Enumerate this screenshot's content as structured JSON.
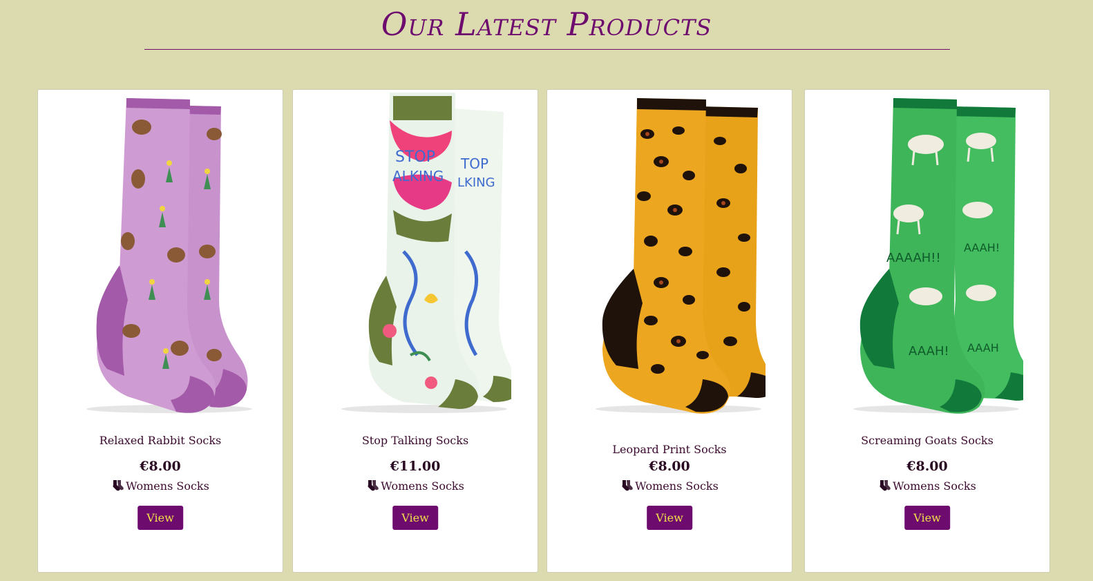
{
  "page": {
    "heading": "Our Latest Products"
  },
  "products": [
    {
      "name": "Relaxed Rabbit Socks",
      "price": "€8.00",
      "category": "Womens Socks",
      "view_label": "View",
      "main_color": "#c893cd",
      "trim_color": "#a35aa8"
    },
    {
      "name": "Stop Talking Socks",
      "price": "€11.00",
      "category": "Womens Socks",
      "view_label": "View",
      "main_color": "#eaf3ea",
      "trim_color": "#6b7d3b",
      "sock_text": "STOP TALKING"
    },
    {
      "name": "Leopard Print Socks",
      "price": "€8.00",
      "category": "Womens Socks",
      "view_label": "View",
      "main_color": "#e8a21a",
      "trim_color": "#1e120b"
    },
    {
      "name": "Screaming Goats Socks",
      "price": "€8.00",
      "category": "Womens Socks",
      "view_label": "View",
      "main_color": "#3fb55a",
      "trim_color": "#117a3a"
    }
  ]
}
